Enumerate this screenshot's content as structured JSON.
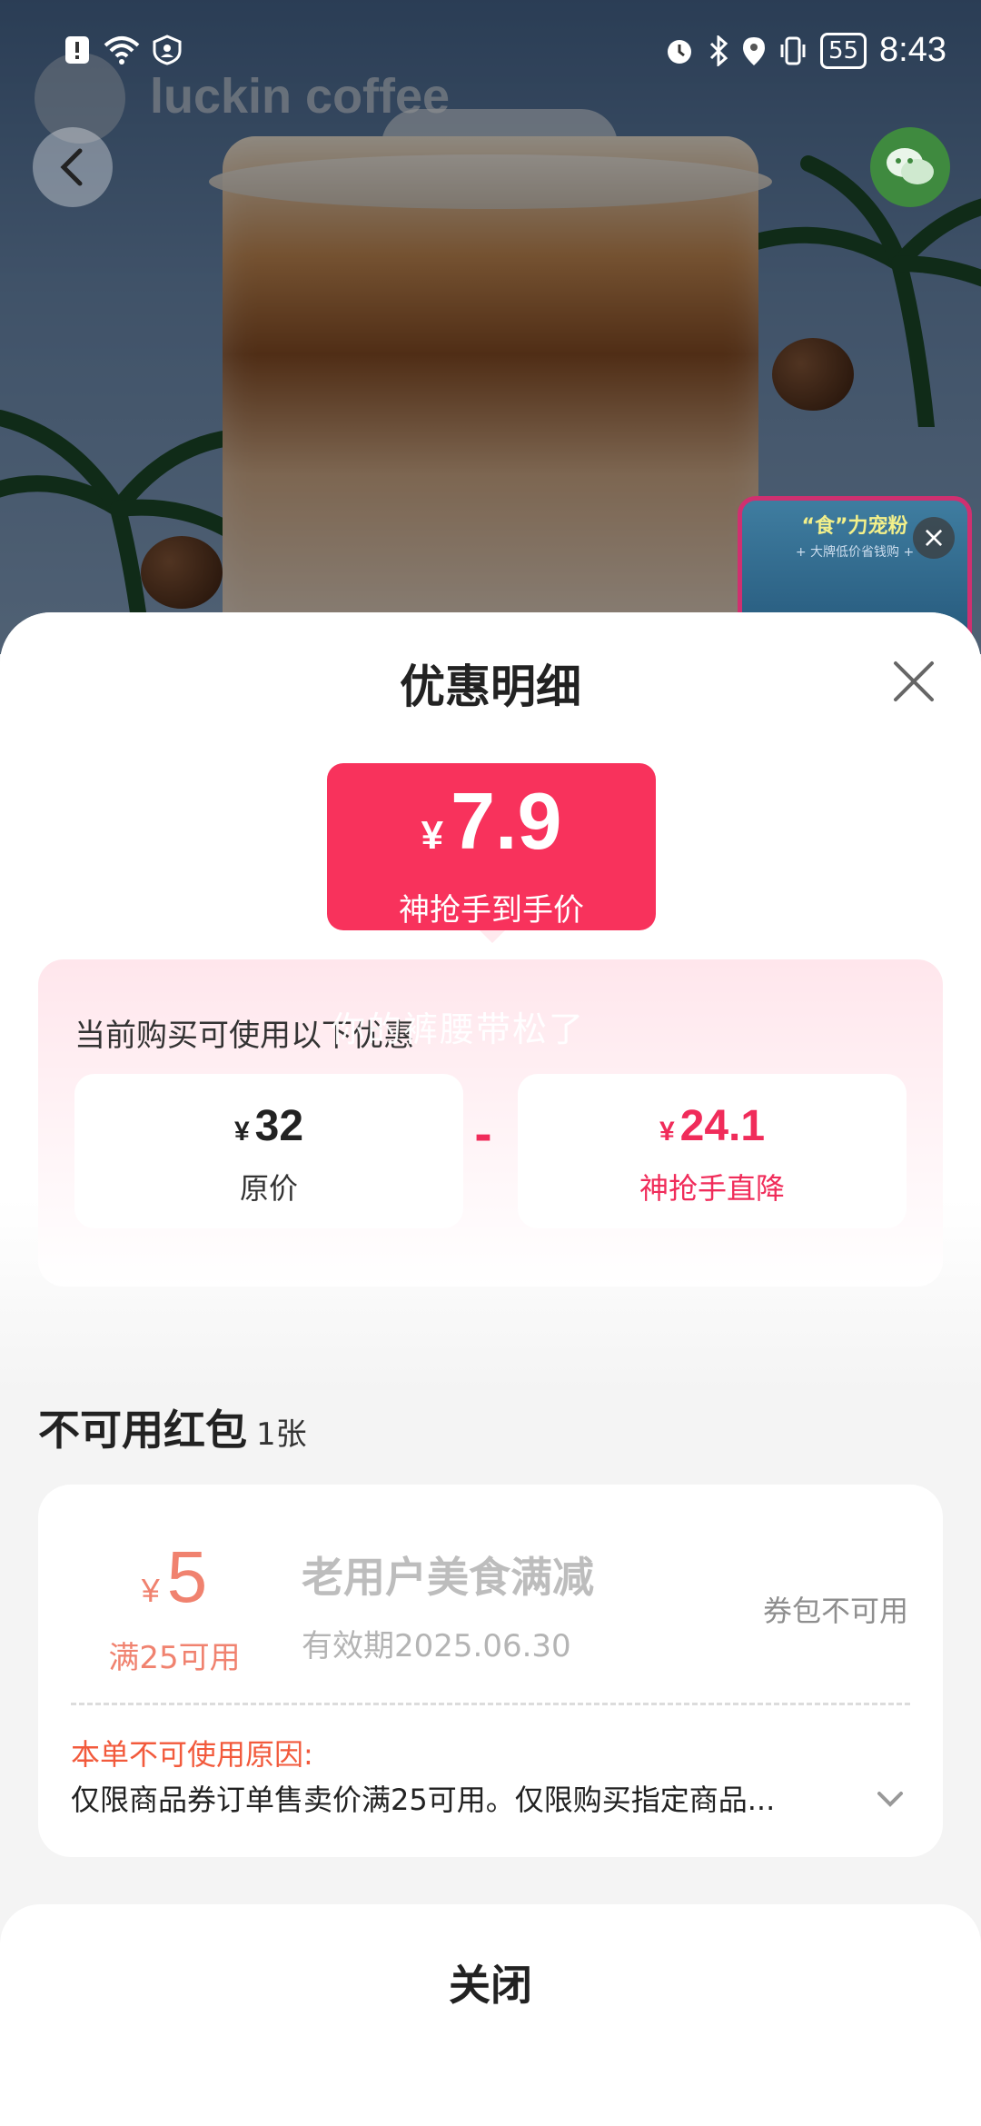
{
  "status_bar": {
    "time": "8:43",
    "battery": "55",
    "icons_left": [
      "alert-icon",
      "wifi-icon",
      "vpn-icon"
    ],
    "icons_right": [
      "alarm-icon",
      "bluetooth-icon",
      "location-icon",
      "vibrate-icon"
    ]
  },
  "hero": {
    "brand": "luckin coffee",
    "promo_title": "“食”力宠粉",
    "promo_subtitle": "+ 大牌低价省钱购 +"
  },
  "sheet": {
    "title": "优惠明细",
    "final_price_currency": "¥",
    "final_price": "7.9",
    "final_price_label": "神抢手到手价",
    "panel_caption": "当前购买可使用以下优惠",
    "watermark": "你的裤腰带松了",
    "original_currency": "¥",
    "original_price": "32",
    "original_label": "原价",
    "minus_sign": "-",
    "discount_currency": "¥",
    "discount_value": "24.1",
    "discount_label": "神抢手直降"
  },
  "unavailable": {
    "title": "不可用红包",
    "count": "1张",
    "coupon": {
      "currency": "¥",
      "amount": "5",
      "condition": "满25可用",
      "name": "老用户美食满减",
      "validity": "有效期2025.06.30",
      "status": "券包不可用",
      "reason_label": "本单不可使用原因:",
      "reason": "仅限商品券订单售卖价满25可用。仅限购买指定商品..."
    }
  },
  "footer": {
    "close_label": "关闭"
  },
  "colors": {
    "accent": "#f8325c",
    "coupon_orange": "#f0826f",
    "reason_red": "#f25a3c"
  }
}
